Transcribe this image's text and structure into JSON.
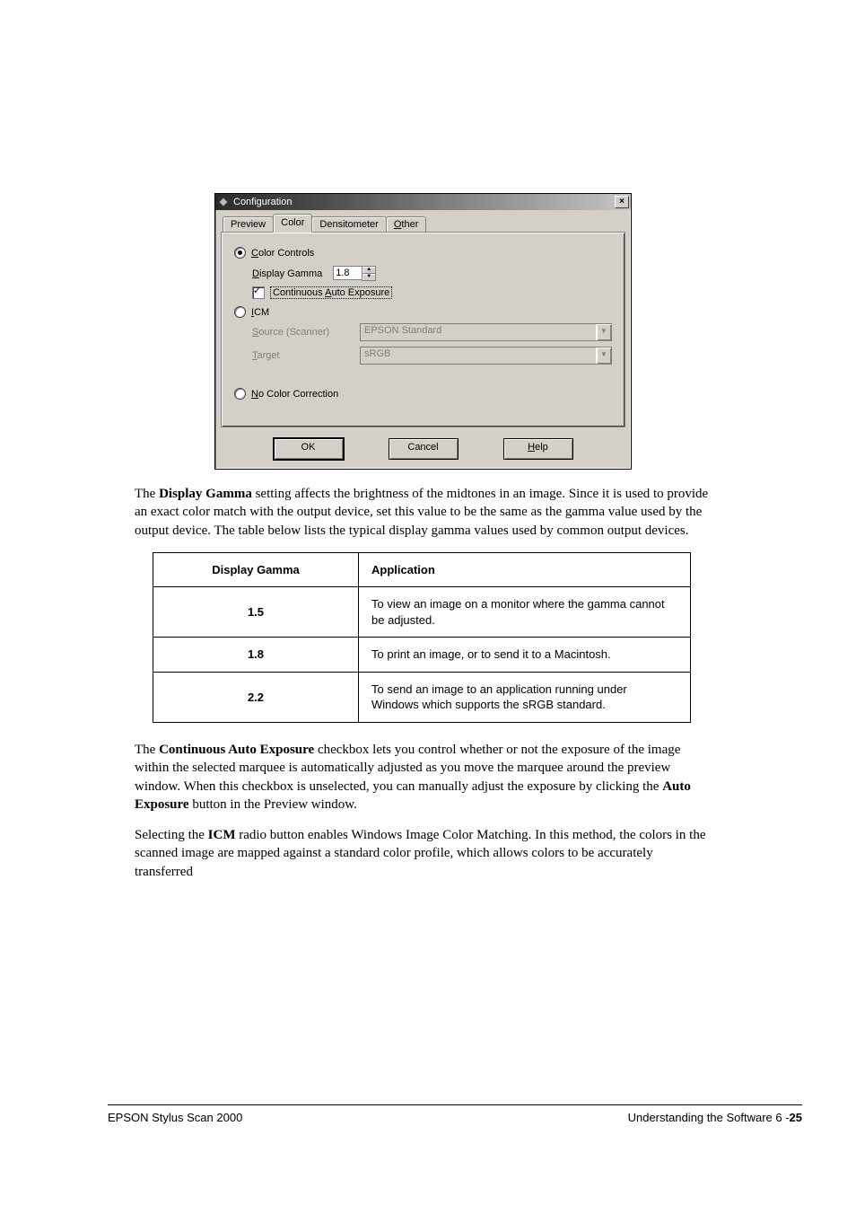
{
  "dialog": {
    "title": "Configuration",
    "close_glyph": "×",
    "tabs": {
      "preview": "Preview",
      "color": "Color",
      "densitometer": "Densitometer",
      "other": "Other"
    },
    "color_controls": {
      "label_prefix": "C",
      "label_rest": "olor Controls",
      "gamma_label_prefix": "D",
      "gamma_label_rest": "isplay Gamma",
      "gamma_value": "1.8",
      "cae_label": "Continuous Auto Exposure",
      "cae_underline": "A"
    },
    "icm": {
      "label_prefix": "I",
      "label_rest": "CM",
      "source_label_prefix": "S",
      "source_label_rest": "ource (Scanner)",
      "source_value": "EPSON Standard",
      "target_label_prefix": "T",
      "target_label_rest": "arget",
      "target_value": "sRGB"
    },
    "no_cc": {
      "label_prefix": "N",
      "label_rest": "o Color Correction"
    },
    "buttons": {
      "ok": "OK",
      "cancel": "Cancel",
      "help_prefix": "H",
      "help_rest": "elp"
    }
  },
  "text": {
    "para1_a": "The ",
    "para1_b": "Display Gamma",
    "para1_c": " setting affects the brightness of the midtones in an image. Since it is used to provide an exact color match with the output device, set this value to be the same as the gamma value used by the output device. The table below lists the typical display gamma values used by common output devices.",
    "thead_col1": "Display Gamma",
    "thead_col2": "Application",
    "row1_col1": "1.5",
    "row1_col2": "To view an image on a monitor where the gamma cannot be adjusted.",
    "row2_col1": "1.8",
    "row2_col2": "To print an image, or to send it to a Macintosh.",
    "row3_col1": "2.2",
    "row3_col2": "To send an image to an application running under Windows which supports the sRGB standard.",
    "para2_a": "The ",
    "para2_b": "Continuous Auto Exposure",
    "para2_c": " checkbox lets you control whether or not the exposure of the image within the selected marquee is automatically adjusted as you move the marquee around the preview window. When this checkbox is unselected, you can manually adjust the exposure by clicking the ",
    "para2_d": "Auto Exposure",
    "para2_e": " button in the Preview window.",
    "para3_a": "Selecting the ",
    "para3_b": "ICM",
    "para3_c": " radio button enables Windows Image Color Matching. In this method, the colors in the scanned image are mapped against a standard color profile, which allows colors to be accurately transferred"
  },
  "footer": {
    "left": "EPSON Stylus Scan 2000",
    "right": "Understanding the Software    6 -",
    "page": "25"
  }
}
